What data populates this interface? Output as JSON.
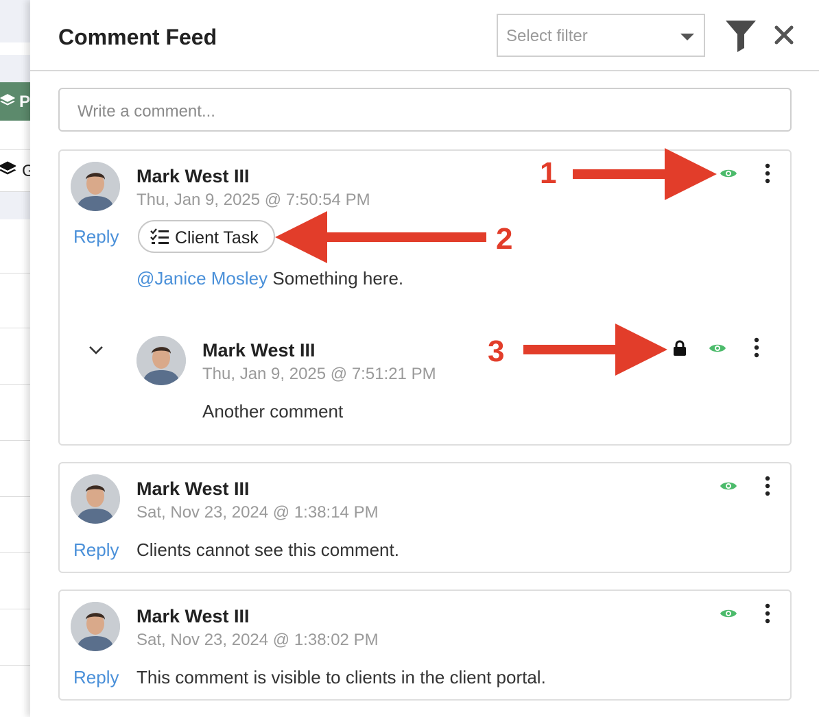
{
  "background_app": {
    "green_button_label": "P",
    "secondary_button_label": "G"
  },
  "header": {
    "title": "Comment Feed",
    "filter_placeholder": "Select filter"
  },
  "composer": {
    "placeholder": "Write a comment..."
  },
  "comments": [
    {
      "author": "Mark West III",
      "date": "Thu, Jan 9, 2025 @ 7:50:54 PM",
      "reply_label": "Reply",
      "tag": "Client Task",
      "mention": "@Janice Mosley",
      "text": " Something here.",
      "replies": [
        {
          "author": "Mark West III",
          "date": "Thu, Jan 9, 2025 @ 7:51:21 PM",
          "text": "Another comment"
        }
      ]
    },
    {
      "author": "Mark West III",
      "date": "Sat, Nov 23, 2024 @ 1:38:14 PM",
      "reply_label": "Reply",
      "text": "Clients cannot see this comment."
    },
    {
      "author": "Mark West III",
      "date": "Sat, Nov 23, 2024 @ 1:38:02 PM",
      "reply_label": "Reply",
      "text": "This comment is visible to clients in the client portal."
    }
  ],
  "annotations": [
    "1",
    "2",
    "3"
  ],
  "colors": {
    "accent_link": "#4a90d9",
    "visible_eye": "#4cbb6b",
    "annotation_red": "#e23d2a",
    "sidebar_green": "#5c8a6c"
  },
  "icons": [
    "funnel-icon",
    "close-icon",
    "eye-icon",
    "more-vert-icon",
    "lock-icon",
    "chevron-down-icon",
    "checklist-icon"
  ]
}
